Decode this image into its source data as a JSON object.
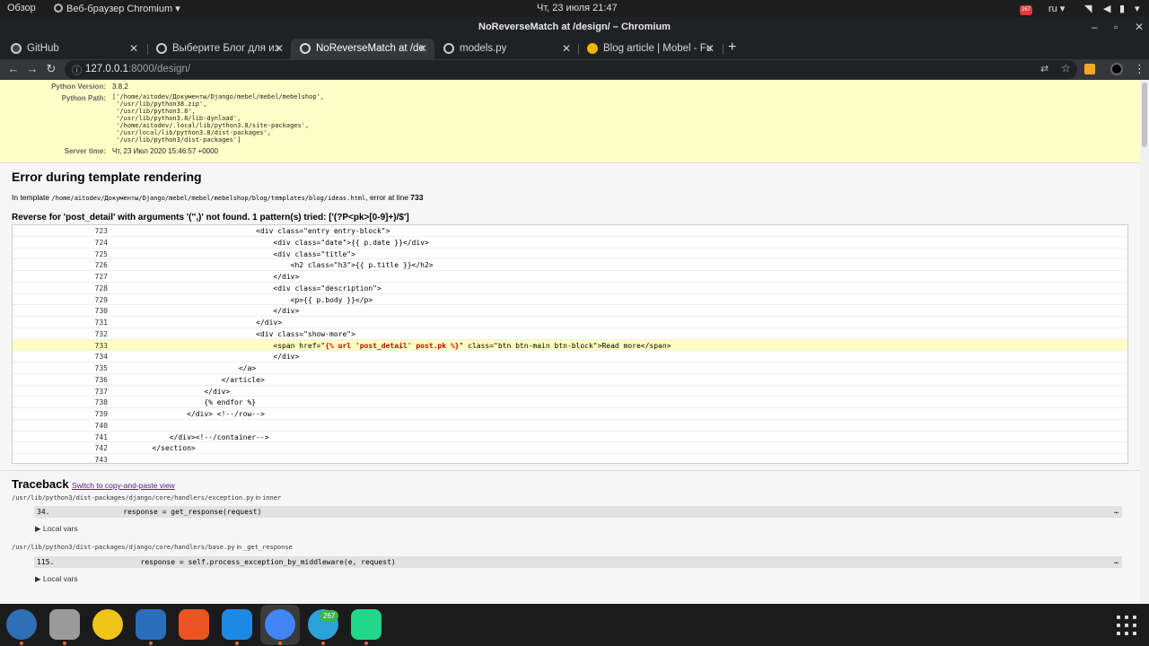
{
  "topbar": {
    "activities": "Обзор",
    "app_menu": "Веб-браузер Chromium",
    "clock": "Чт, 23 июля  21:47",
    "badge": "267",
    "lang": "ru"
  },
  "window": {
    "title": "NoReverseMatch at /design/ – Chromium",
    "minimize": "–",
    "restore": "▫",
    "close": "✕"
  },
  "tabs": [
    {
      "label": "GitHub",
      "close": "✕",
      "active": false
    },
    {
      "label": "Выберите Блог для изме",
      "close": "✕",
      "active": false
    },
    {
      "label": "NoReverseMatch at /desi",
      "close": "✕",
      "active": true
    },
    {
      "label": "models.py",
      "close": "✕",
      "active": false
    },
    {
      "label": "Blog article | Mobel - Furn",
      "close": "✕",
      "active": false
    }
  ],
  "new_tab": "+",
  "toolbar": {
    "back": "←",
    "forward": "→",
    "reload": "↻",
    "url_host": "127.0.0.1",
    "url_rest": ":8000/design/",
    "translate": "⇄",
    "star": "☆",
    "menu": "⋮"
  },
  "summary": {
    "python_version_label": "Python Version:",
    "python_version": "3.8.2",
    "python_path_label": "Python Path:",
    "python_path": [
      "['/home/aitodev/Документы/Django/mebel/mebel/mebelshop',",
      " '/usr/lib/python38.zip',",
      " '/usr/lib/python3.8',",
      " '/usr/lib/python3.8/lib-dynload',",
      " '/home/aitodev/.local/lib/python3.8/site-packages',",
      " '/usr/local/lib/python3.8/dist-packages',",
      " '/usr/lib/python3/dist-packages']"
    ],
    "server_time_label": "Server time:",
    "server_time": "Чт, 23 Июл 2020 15:46:57 +0000"
  },
  "template_error": {
    "heading": "Error during template rendering",
    "in_template_prefix": "In template ",
    "template_path": "/home/aitodev/Документы/Django/mebel/mebel/mebelshop/blog/templates/blog/ideas.html",
    "error_at": ", error at line ",
    "line": "733",
    "message": "Reverse for 'post_detail' with arguments '('',)' not found. 1 pattern(s) tried: ['(?P<pk>[0-9]+)/$']",
    "source": [
      {
        "n": "723",
        "code": "                                <div class=\"entry entry-block\">"
      },
      {
        "n": "724",
        "code": "                                    <div class=\"date\">{{ p.date }}</div>"
      },
      {
        "n": "725",
        "code": "                                    <div class=\"title\">"
      },
      {
        "n": "726",
        "code": "                                        <h2 class=\"h3\">{{ p.title }}</h2>"
      },
      {
        "n": "727",
        "code": "                                    </div>"
      },
      {
        "n": "728",
        "code": "                                    <div class=\"description\">"
      },
      {
        "n": "729",
        "code": "                                        <p>{{ p.body }}</p>"
      },
      {
        "n": "730",
        "code": "                                    </div>"
      },
      {
        "n": "731",
        "code": "                                </div>"
      },
      {
        "n": "732",
        "code": "                                <div class=\"show-more\">"
      },
      {
        "n": "733",
        "pre": "                                    <span href=\"",
        "tag": "{% url 'post_detail' post.pk %}",
        "post": "\" class=\"btn btn-main btn-block\">Read more</span>"
      },
      {
        "n": "734",
        "code": "                                    </div>"
      },
      {
        "n": "735",
        "code": "                            </a>"
      },
      {
        "n": "736",
        "code": "                        </article>"
      },
      {
        "n": "737",
        "code": "                    </div>"
      },
      {
        "n": "738",
        "code": "                    {% endfor %}"
      },
      {
        "n": "739",
        "code": "                </div> <!--/row-->"
      },
      {
        "n": "740",
        "code": ""
      },
      {
        "n": "741",
        "code": "            </div><!--/container-->"
      },
      {
        "n": "742",
        "code": "        </section>"
      },
      {
        "n": "743",
        "code": ""
      }
    ]
  },
  "traceback": {
    "heading": "Traceback",
    "switch_link": "Switch to copy-and-paste view",
    "frames": [
      {
        "file": "/usr/lib/python3/dist-packages/django/core/handlers/exception.py",
        "in": " in ",
        "func": "inner",
        "num": "34.",
        "code": "    response = get_response(request)",
        "ellipsis": "…",
        "local_vars": "▶ Local vars"
      },
      {
        "file": "/usr/lib/python3/dist-packages/django/core/handlers/base.py",
        "in": " in ",
        "func": "_get_response",
        "num": "115.",
        "code": "        response = self.process_exception_by_middleware(e, request)",
        "ellipsis": "…",
        "local_vars": "▶ Local vars"
      }
    ]
  },
  "dock": {
    "telegram_badge": "267"
  }
}
